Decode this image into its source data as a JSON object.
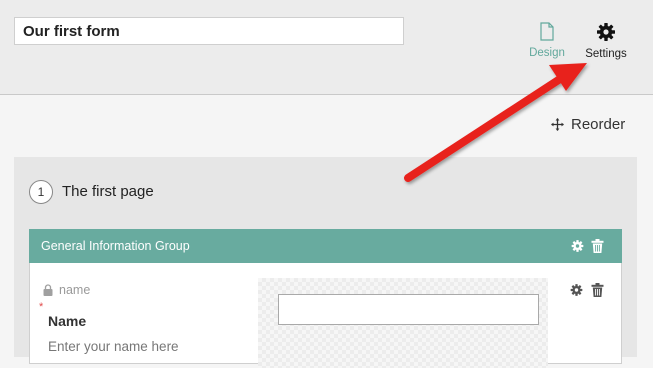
{
  "form": {
    "title": "Our first form"
  },
  "toolbar": {
    "design_label": "Design",
    "design_icon": "document-icon",
    "settings_label": "Settings",
    "settings_icon": "gear-icon"
  },
  "reorder": {
    "label": "Reorder",
    "icon": "move-arrows-icon"
  },
  "page": {
    "number": "1",
    "title": "The first page"
  },
  "group": {
    "title": "General Information Group",
    "actions": [
      "gear-icon",
      "trash-icon"
    ]
  },
  "field": {
    "id": "name",
    "id_icon": "lock-icon",
    "required_marker": "*",
    "label": "Name",
    "placeholder_text": "Enter your name here",
    "actions": [
      "gear-icon",
      "trash-icon"
    ]
  },
  "colors": {
    "accent": "#68ab9f",
    "design_link": "#62a89c",
    "annotation_arrow": "#e8231f",
    "required": "#e14b4b"
  }
}
